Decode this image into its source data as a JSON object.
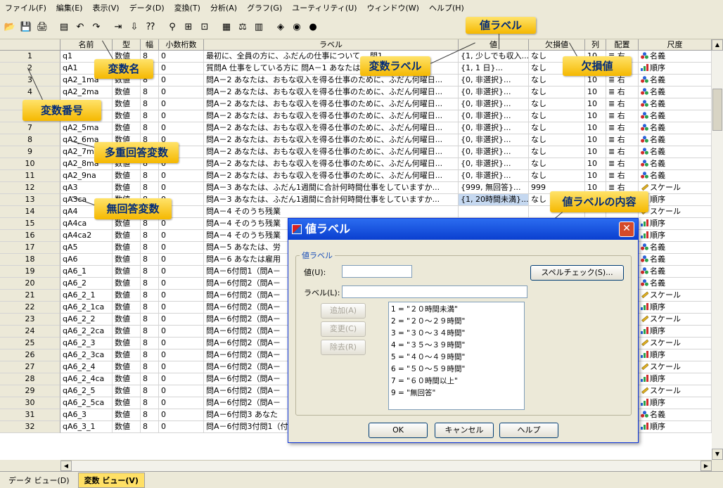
{
  "menu": [
    "ファイル(F)",
    "編集(E)",
    "表示(V)",
    "データ(D)",
    "変換(T)",
    "分析(A)",
    "グラフ(G)",
    "ユーティリティ(U)",
    "ウィンドウ(W)",
    "ヘルプ(H)"
  ],
  "toolbar_icons": [
    "open-icon",
    "save-icon",
    "print-icon",
    "dialog-recall-icon",
    "undo-icon",
    "redo-icon",
    "goto-case-icon",
    "goto-variable-icon",
    "variables-icon",
    "find-icon",
    "insert-cases-icon",
    "insert-variable-icon",
    "split-file-icon",
    "weight-cases-icon",
    "select-cases-icon",
    "value-labels-icon",
    "use-sets-icon",
    "show-all-icon"
  ],
  "columns": [
    "名前",
    "型",
    "幅",
    "小数桁数",
    "ラベル",
    "値",
    "欠損値",
    "列",
    "配置",
    "尺度"
  ],
  "rows": [
    {
      "n": "1",
      "name": "q1",
      "type": "数値",
      "width": "8",
      "dec": "0",
      "label": "最初に、全員の方に、ふだんの仕事について... 問1 ...",
      "value": "{1, 少しでも収入...",
      "missing": "なし",
      "cols": "10",
      "align": "右",
      "measure": "名義",
      "measure_kind": "nominal"
    },
    {
      "n": "2",
      "name": "qA1",
      "type": "数値",
      "width": "8",
      "dec": "0",
      "label": "質問A 仕事をしている方に 問A－1 あなたは...収入を得る...",
      "value": "{1, 1 日}...",
      "missing": "なし",
      "cols": "10",
      "align": "右",
      "measure": "順序",
      "measure_kind": "ordinal"
    },
    {
      "n": "3",
      "name": "qA2_1ma",
      "type": "数値",
      "width": "8",
      "dec": "0",
      "label": "問A－2 あなたは、おもな収入を得る仕事のために、ふだん何曜日...",
      "value": "{0, 非選択}...",
      "missing": "なし",
      "cols": "10",
      "align": "右",
      "measure": "名義",
      "measure_kind": "nominal"
    },
    {
      "n": "4",
      "name": "qA2_2ma",
      "type": "数値",
      "width": "8",
      "dec": "0",
      "label": "問A－2 あなたは、おもな収入を得る仕事のために、ふだん何曜日...",
      "value": "{0, 非選択}...",
      "missing": "なし",
      "cols": "10",
      "align": "右",
      "measure": "名義",
      "measure_kind": "nominal"
    },
    {
      "n": "5",
      "name": "qA2_3ma",
      "type": "数値",
      "width": "8",
      "dec": "0",
      "label": "問A－2 あなたは、おもな収入を得る仕事のために、ふだん何曜日...",
      "value": "{0, 非選択}...",
      "missing": "なし",
      "cols": "10",
      "align": "右",
      "measure": "名義",
      "measure_kind": "nominal"
    },
    {
      "n": "6",
      "name": "qA2_4ma",
      "type": "数値",
      "width": "8",
      "dec": "0",
      "label": "問A－2 あなたは、おもな収入を得る仕事のために、ふだん何曜日...",
      "value": "{0, 非選択}...",
      "missing": "なし",
      "cols": "10",
      "align": "右",
      "measure": "名義",
      "measure_kind": "nominal"
    },
    {
      "n": "7",
      "name": "qA2_5ma",
      "type": "数値",
      "width": "8",
      "dec": "0",
      "label": "問A－2 あなたは、おもな収入を得る仕事のために、ふだん何曜日...",
      "value": "{0, 非選択}...",
      "missing": "なし",
      "cols": "10",
      "align": "右",
      "measure": "名義",
      "measure_kind": "nominal"
    },
    {
      "n": "8",
      "name": "qA2_6ma",
      "type": "数値",
      "width": "8",
      "dec": "0",
      "label": "問A－2 あなたは、おもな収入を得る仕事のために、ふだん何曜日...",
      "value": "{0, 非選択}...",
      "missing": "なし",
      "cols": "10",
      "align": "右",
      "measure": "名義",
      "measure_kind": "nominal"
    },
    {
      "n": "9",
      "name": "qA2_7ma",
      "type": "数値",
      "width": "8",
      "dec": "0",
      "label": "問A－2 あなたは、おもな収入を得る仕事のために、ふだん何曜日...",
      "value": "{0, 非選択}...",
      "missing": "なし",
      "cols": "10",
      "align": "右",
      "measure": "名義",
      "measure_kind": "nominal"
    },
    {
      "n": "10",
      "name": "qA2_8ma",
      "type": "数値",
      "width": "8",
      "dec": "0",
      "label": "問A－2 あなたは、おもな収入を得る仕事のために、ふだん何曜日...",
      "value": "{0, 非選択}...",
      "missing": "なし",
      "cols": "10",
      "align": "右",
      "measure": "名義",
      "measure_kind": "nominal"
    },
    {
      "n": "11",
      "name": "qA2_9na",
      "type": "数値",
      "width": "8",
      "dec": "0",
      "label": "問A－2 あなたは、おもな収入を得る仕事のために、ふだん何曜日...",
      "value": "{0, 非選択}...",
      "missing": "なし",
      "cols": "10",
      "align": "右",
      "measure": "名義",
      "measure_kind": "nominal"
    },
    {
      "n": "12",
      "name": "qA3",
      "type": "数値",
      "width": "8",
      "dec": "0",
      "label": "問A－3 あなたは、ふだん1週間に合計何時間仕事をしていますか...",
      "value": "{999, 無回答}...",
      "missing": "999",
      "cols": "10",
      "align": "右",
      "measure": "スケール",
      "measure_kind": "scale"
    },
    {
      "n": "13",
      "name": "qA3ca",
      "type": "数値",
      "width": "8",
      "dec": "0",
      "label": "問A－3 あなたは、ふだん1週間に合計何時間仕事をしていますか...",
      "value": "{1, 20時間未満}...",
      "missing": "なし",
      "cols": "10",
      "align": "右",
      "measure": "順序",
      "measure_kind": "ordinal",
      "selected": true
    },
    {
      "n": "14",
      "name": "qA4",
      "type": "数値",
      "width": "8",
      "dec": "0",
      "label": "問A－4 そのうち残業",
      "value": "",
      "missing": "",
      "cols": "",
      "align": "",
      "measure": "スケール",
      "measure_kind": "scale"
    },
    {
      "n": "15",
      "name": "qA4ca",
      "type": "数値",
      "width": "8",
      "dec": "0",
      "label": "問A－4 そのうち残業",
      "value": "",
      "missing": "",
      "cols": "",
      "align": "",
      "measure": "順序",
      "measure_kind": "ordinal"
    },
    {
      "n": "16",
      "name": "qA4ca2",
      "type": "数値",
      "width": "8",
      "dec": "0",
      "label": "問A－4 そのうち残業",
      "value": "",
      "missing": "",
      "cols": "",
      "align": "",
      "measure": "順序",
      "measure_kind": "ordinal"
    },
    {
      "n": "17",
      "name": "qA5",
      "type": "数値",
      "width": "8",
      "dec": "0",
      "label": "問A－5 あなたは、労",
      "value": "",
      "missing": "",
      "cols": "",
      "align": "",
      "measure": "名義",
      "measure_kind": "nominal"
    },
    {
      "n": "18",
      "name": "qA6",
      "type": "数値",
      "width": "8",
      "dec": "0",
      "label": "問A－6 あなたは雇用",
      "value": "",
      "missing": "",
      "cols": "",
      "align": "",
      "measure": "名義",
      "measure_kind": "nominal"
    },
    {
      "n": "19",
      "name": "qA6_1",
      "type": "数値",
      "width": "8",
      "dec": "0",
      "label": "問A－6付問1（問A－",
      "value": "",
      "missing": "",
      "cols": "",
      "align": "",
      "measure": "名義",
      "measure_kind": "nominal"
    },
    {
      "n": "20",
      "name": "qA6_2",
      "type": "数値",
      "width": "8",
      "dec": "0",
      "label": "問A－6付問2（問A－",
      "value": "",
      "missing": "",
      "cols": "",
      "align": "",
      "measure": "名義",
      "measure_kind": "nominal"
    },
    {
      "n": "21",
      "name": "qA6_2_1",
      "type": "数値",
      "width": "8",
      "dec": "0",
      "label": "問A－6付問2（問A－",
      "value": "",
      "missing": "",
      "cols": "",
      "align": "",
      "measure": "スケール",
      "measure_kind": "scale"
    },
    {
      "n": "22",
      "name": "qA6_2_1ca",
      "type": "数値",
      "width": "8",
      "dec": "0",
      "label": "問A－6付問2（問A－",
      "value": "",
      "missing": "",
      "cols": "",
      "align": "",
      "measure": "順序",
      "measure_kind": "ordinal"
    },
    {
      "n": "23",
      "name": "qA6_2_2",
      "type": "数値",
      "width": "8",
      "dec": "0",
      "label": "問A－6付問2（問A－",
      "value": "",
      "missing": "",
      "cols": "",
      "align": "",
      "measure": "スケール",
      "measure_kind": "scale"
    },
    {
      "n": "24",
      "name": "qA6_2_2ca",
      "type": "数値",
      "width": "8",
      "dec": "0",
      "label": "問A－6付問2（問A－",
      "value": "",
      "missing": "",
      "cols": "",
      "align": "",
      "measure": "順序",
      "measure_kind": "ordinal"
    },
    {
      "n": "25",
      "name": "qA6_2_3",
      "type": "数値",
      "width": "8",
      "dec": "0",
      "label": "問A－6付問2（問A－",
      "value": "",
      "missing": "",
      "cols": "",
      "align": "",
      "measure": "スケール",
      "measure_kind": "scale"
    },
    {
      "n": "26",
      "name": "qA6_2_3ca",
      "type": "数値",
      "width": "8",
      "dec": "0",
      "label": "問A－6付問2（問A－",
      "value": "",
      "missing": "",
      "cols": "",
      "align": "",
      "measure": "順序",
      "measure_kind": "ordinal"
    },
    {
      "n": "27",
      "name": "qA6_2_4",
      "type": "数値",
      "width": "8",
      "dec": "0",
      "label": "問A－6付問2（問A－",
      "value": "",
      "missing": "",
      "cols": "",
      "align": "",
      "measure": "スケール",
      "measure_kind": "scale"
    },
    {
      "n": "28",
      "name": "qA6_2_4ca",
      "type": "数値",
      "width": "8",
      "dec": "0",
      "label": "問A－6付問2（問A－",
      "value": "",
      "missing": "",
      "cols": "",
      "align": "",
      "measure": "順序",
      "measure_kind": "ordinal"
    },
    {
      "n": "29",
      "name": "qA6_2_5",
      "type": "数値",
      "width": "8",
      "dec": "0",
      "label": "問A－6付問2（問A－",
      "value": "",
      "missing": "",
      "cols": "",
      "align": "",
      "measure": "スケール",
      "measure_kind": "scale"
    },
    {
      "n": "30",
      "name": "qA6_2_5ca",
      "type": "数値",
      "width": "8",
      "dec": "0",
      "label": "問A－6付問2（問A－",
      "value": "",
      "missing": "",
      "cols": "",
      "align": "",
      "measure": "順序",
      "measure_kind": "ordinal"
    },
    {
      "n": "31",
      "name": "qA6_3",
      "type": "数値",
      "width": "8",
      "dec": "0",
      "label": "問A－6付問3 あなた",
      "value": "",
      "missing": "",
      "cols": "",
      "align": "",
      "measure": "名義",
      "measure_kind": "nominal"
    },
    {
      "n": "32",
      "name": "qA6_3_1",
      "type": "数値",
      "width": "8",
      "dec": "0",
      "label": "問A－6付問3付問1（付問3で2と答えた方におたずねします）あな...",
      "value": "{1, 1ヶ月未満}...",
      "missing": "なし",
      "cols": "10",
      "align": "右",
      "measure": "順序",
      "measure_kind": "ordinal"
    }
  ],
  "callouts": {
    "value_label": "値ラベル",
    "var_name": "変数名",
    "var_label": "変数ラベル",
    "missing": "欠損値",
    "var_number": "変数番号",
    "multi": "多重回答変数",
    "no_answer": "無回答変数",
    "value_content": "値ラベルの内容"
  },
  "dialog": {
    "title": "値ラベル",
    "group_label": "値ラベル",
    "value_label": "値(U):",
    "value_input": "",
    "label_label": "ラベル(L):",
    "label_input": "",
    "spell": "スペルチェック(S)...",
    "add": "追加(A)",
    "change": "変更(C)",
    "remove": "除去(R)",
    "list": [
      "1 = \"２０時間未満\"",
      "2 = \"２０～２９時間\"",
      "3 = \"３０～３４時間\"",
      "4 = \"３５～３９時間\"",
      "5 = \"４０～４９時間\"",
      "6 = \"５０～５９時間\"",
      "7 = \"６０時間以上\"",
      "9 = \"無回答\""
    ],
    "ok": "OK",
    "cancel": "キャンセル",
    "help": "ヘルプ"
  },
  "tabs": [
    "データ ビュー(D)",
    "変数 ビュー(V)"
  ],
  "active_tab": 1,
  "colors": {
    "callout": "#f5b800",
    "callout_text": "#002a7a",
    "title_bar": "#0a3fcf",
    "selected_cell": "#c5d8f0"
  }
}
